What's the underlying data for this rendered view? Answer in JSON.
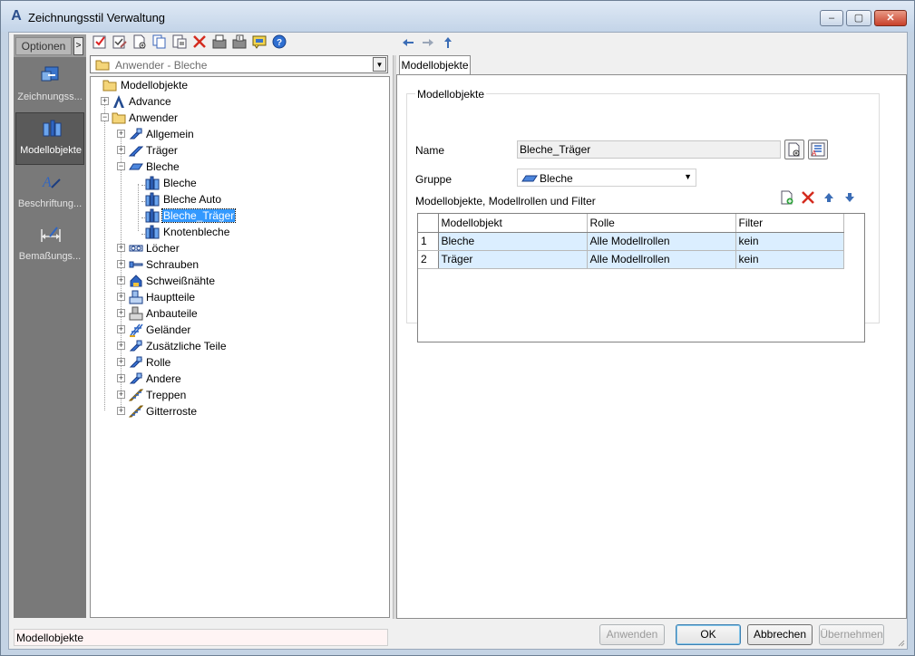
{
  "window": {
    "title": "Zeichnungsstil Verwaltung",
    "app_icon": "A",
    "controls": [
      "minimize",
      "maximize",
      "close"
    ]
  },
  "options_bar": {
    "header": "Optionen",
    "collapse": ">",
    "items": [
      {
        "label": "Zeichnungss...",
        "icon": "drawing-style-icon",
        "active": false
      },
      {
        "label": "Modellobjekte",
        "icon": "model-objects-icon",
        "active": true
      },
      {
        "label": "Beschriftung...",
        "icon": "labeling-icon",
        "active": false
      },
      {
        "label": "Bemaßungs...",
        "icon": "dimension-icon",
        "active": false
      }
    ]
  },
  "toolbar": {
    "icons": [
      "check-icon",
      "check-edit-icon",
      "new-doc-icon",
      "copy-icon",
      "paste-icon",
      "delete-icon",
      "export-icon",
      "import-icon",
      "comment-icon",
      "help-icon"
    ],
    "nav": [
      "back-arrow-icon",
      "forward-arrow-icon",
      "up-arrow-icon"
    ]
  },
  "filter_combo": {
    "value": "Anwender - Bleche"
  },
  "tree": {
    "nodes": [
      {
        "label": "Modellobjekte"
      },
      {
        "label": "Advance"
      },
      {
        "label": "Anwender"
      },
      {
        "label": "Allgemein"
      },
      {
        "label": "Träger"
      },
      {
        "label": "Bleche"
      },
      {
        "label": "Bleche"
      },
      {
        "label": "Bleche Auto"
      },
      {
        "label": "Bleche_Träger"
      },
      {
        "label": "Knotenbleche"
      },
      {
        "label": "Löcher"
      },
      {
        "label": "Schrauben"
      },
      {
        "label": "Schweißnähte"
      },
      {
        "label": "Hauptteile"
      },
      {
        "label": "Anbauteile"
      },
      {
        "label": "Geländer"
      },
      {
        "label": "Zusätzliche Teile"
      },
      {
        "label": "Rolle"
      },
      {
        "label": "Andere"
      },
      {
        "label": "Treppen"
      },
      {
        "label": "Gitterroste"
      }
    ]
  },
  "tab": {
    "label": "Modellobjekte"
  },
  "panel": {
    "group_title": "Modellobjekte",
    "name_label": "Name",
    "name_value": "Bleche_Träger",
    "gruppe_label": "Gruppe",
    "gruppe_value": "Bleche",
    "grid_caption": "Modellobjekte, Modellrollen und Filter",
    "columns": [
      "Modellobjekt",
      "Rolle",
      "Filter"
    ],
    "rows": [
      {
        "num": "1",
        "modellobjekt": "Bleche",
        "rolle": "Alle Modellrollen",
        "filter": "kein"
      },
      {
        "num": "2",
        "modellobjekt": "Träger",
        "rolle": "Alle Modellrollen",
        "filter": "kein"
      }
    ]
  },
  "status": {
    "text": "Modellobjekte"
  },
  "buttons": {
    "apply": "Anwenden",
    "ok": "OK",
    "cancel": "Abbrechen",
    "adopt": "Übernehmen"
  }
}
